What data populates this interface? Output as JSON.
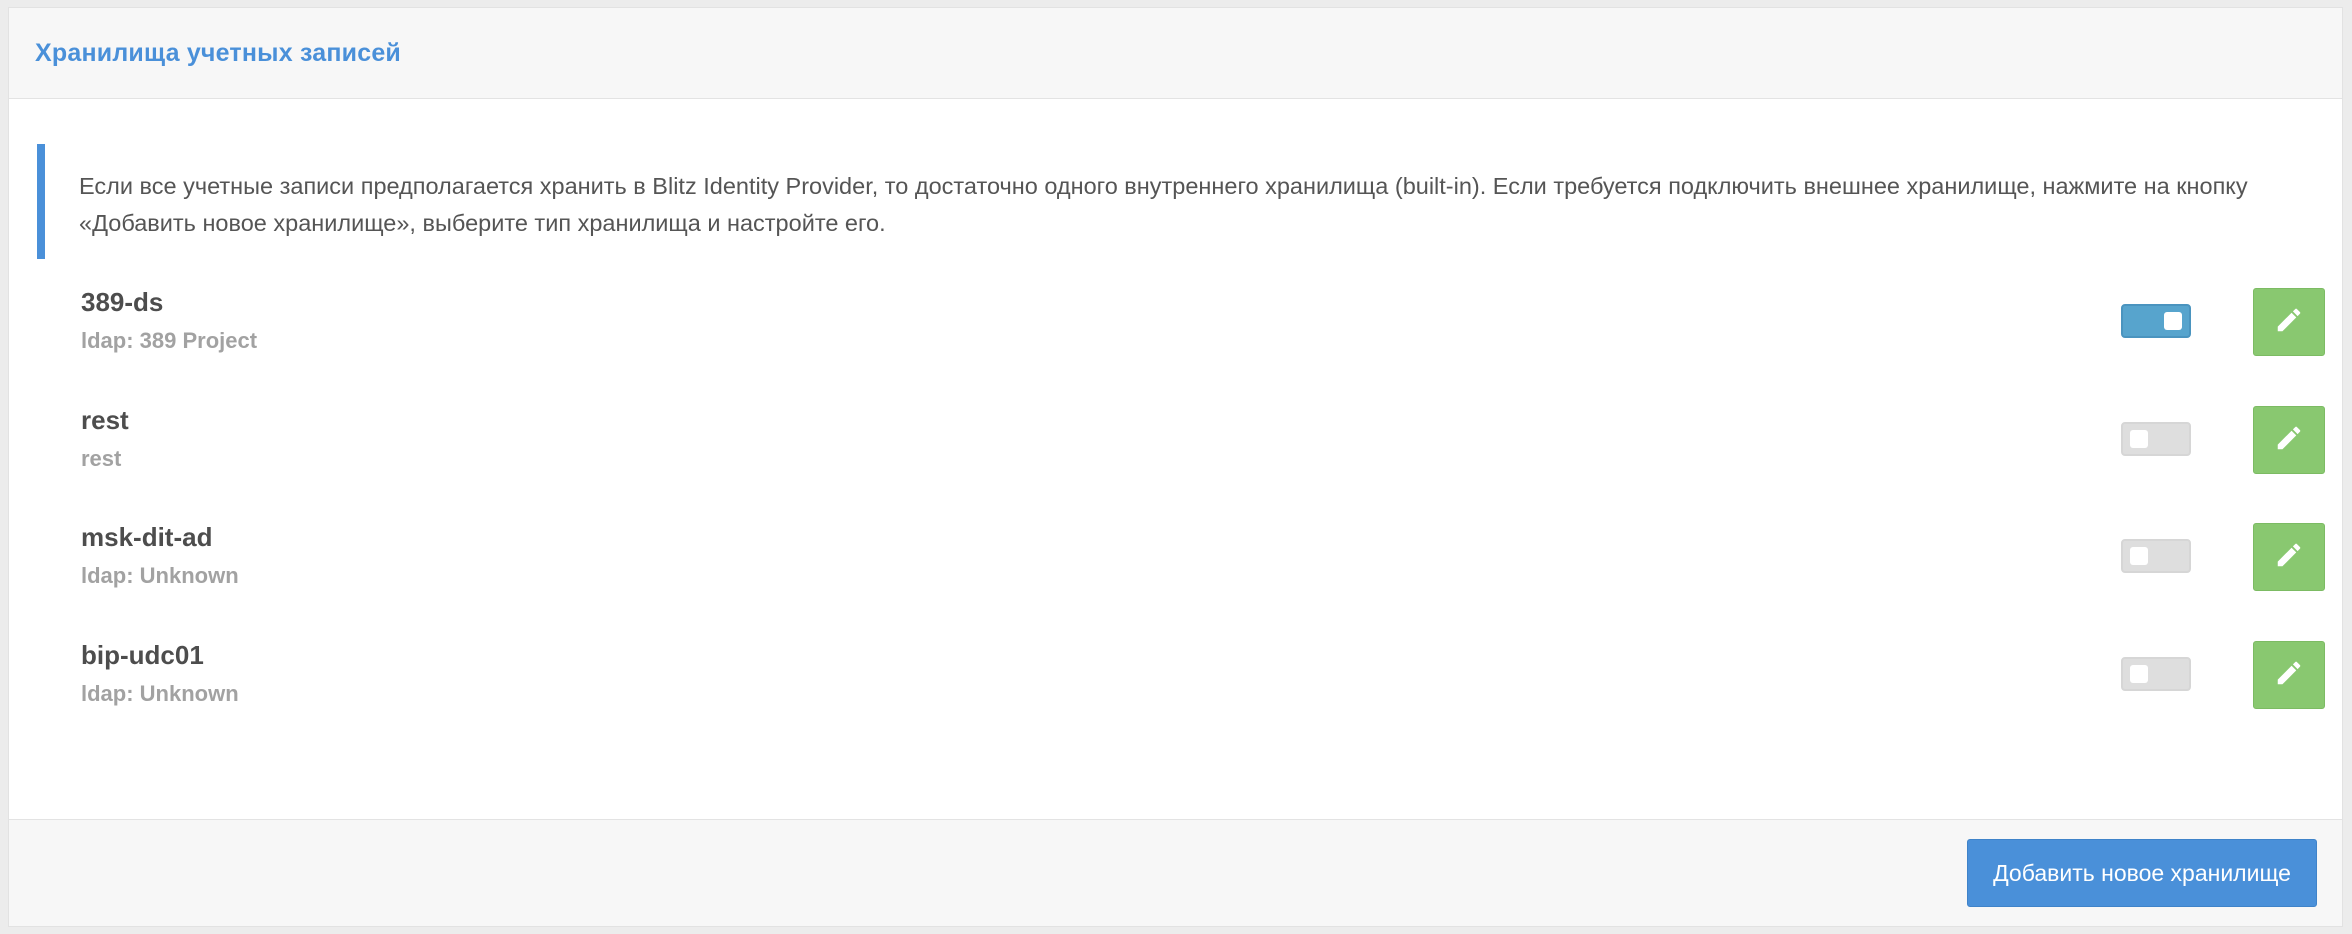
{
  "panel": {
    "title": "Хранилища учетных записей"
  },
  "info": {
    "text": "Если все учетные записи предполагается хранить в Blitz Identity Provider, то достаточно одного внутреннего хранилища (built-in). Если требуется подключить внешнее хранилище, нажмите на кнопку «Добавить новое хранилище», выберите тип хранилища и настройте его.",
    "accent_color": "#4a90d9"
  },
  "stores": [
    {
      "name": "389-ds",
      "type": "ldap: 389 Project",
      "enabled": true,
      "edit_icon": "pencil-icon"
    },
    {
      "name": "rest",
      "type": "rest",
      "enabled": false,
      "edit_icon": "pencil-icon"
    },
    {
      "name": "msk-dit-ad",
      "type": "ldap: Unknown",
      "enabled": false,
      "edit_icon": "pencil-icon"
    },
    {
      "name": "bip-udc01",
      "type": "ldap: Unknown",
      "enabled": false,
      "edit_icon": "pencil-icon"
    }
  ],
  "footer": {
    "add_button_label": "Добавить новое хранилище"
  },
  "colors": {
    "primary": "#4a90d9",
    "toggle_on": "#57a4cd",
    "toggle_off": "#dedede",
    "edit_button": "#89c870"
  }
}
